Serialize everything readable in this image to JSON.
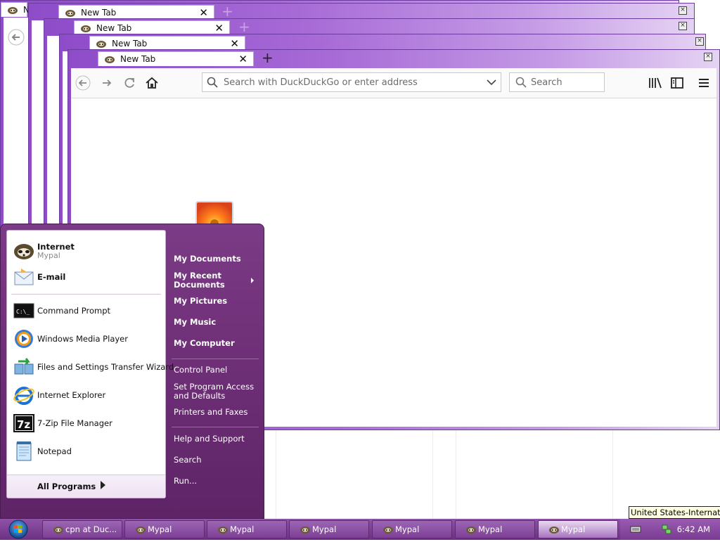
{
  "browser": {
    "tab_title": "New Tab",
    "partial_tab_title": "N",
    "new_tab_symbol": "+",
    "close_symbol": "✕",
    "window_close_symbol": "×",
    "url_placeholder": "Search with DuckDuckGo or enter address",
    "search_placeholder": "Search",
    "icons": [
      "back-icon",
      "forward-icon",
      "reload-icon",
      "home-icon",
      "search-icon",
      "dropdown-icon",
      "library-icon",
      "sidebar-icon",
      "menu-icon"
    ]
  },
  "start_menu": {
    "pinned": [
      {
        "label": "Internet",
        "sub": "Mypal",
        "icon": "mypal-icon"
      },
      {
        "label": "E-mail",
        "icon": "email-icon"
      }
    ],
    "recent": [
      {
        "label": "Command Prompt",
        "icon": "command-prompt-icon"
      },
      {
        "label": "Windows Media Player",
        "icon": "media-player-icon"
      },
      {
        "label": "Files and Settings Transfer Wizard",
        "icon": "transfer-wizard-icon"
      },
      {
        "label": "Internet Explorer",
        "icon": "internet-explorer-icon"
      },
      {
        "label": "7-Zip File Manager",
        "icon": "7zip-icon"
      },
      {
        "label": "Notepad",
        "icon": "notepad-icon"
      }
    ],
    "all_programs": "All Programs",
    "places": [
      "My Documents",
      "My Recent Documents",
      "My Pictures",
      "My Music",
      "My Computer"
    ],
    "system": [
      "Control Panel",
      "Set Program Access and Defaults",
      "Printers and Faxes"
    ],
    "help": [
      "Help and Support",
      "Search",
      "Run..."
    ],
    "cmd_icon_text": "C:\\_",
    "zip_icon_text": "7z"
  },
  "taskbar": {
    "buttons": [
      {
        "label": "cpn at Duc..."
      },
      {
        "label": "Mypal"
      },
      {
        "label": "Mypal"
      },
      {
        "label": "Mypal"
      },
      {
        "label": "Mypal"
      },
      {
        "label": "Mypal"
      },
      {
        "label": "Mypal"
      }
    ],
    "clock": "6:42 AM",
    "tooltip": "United States-International"
  }
}
